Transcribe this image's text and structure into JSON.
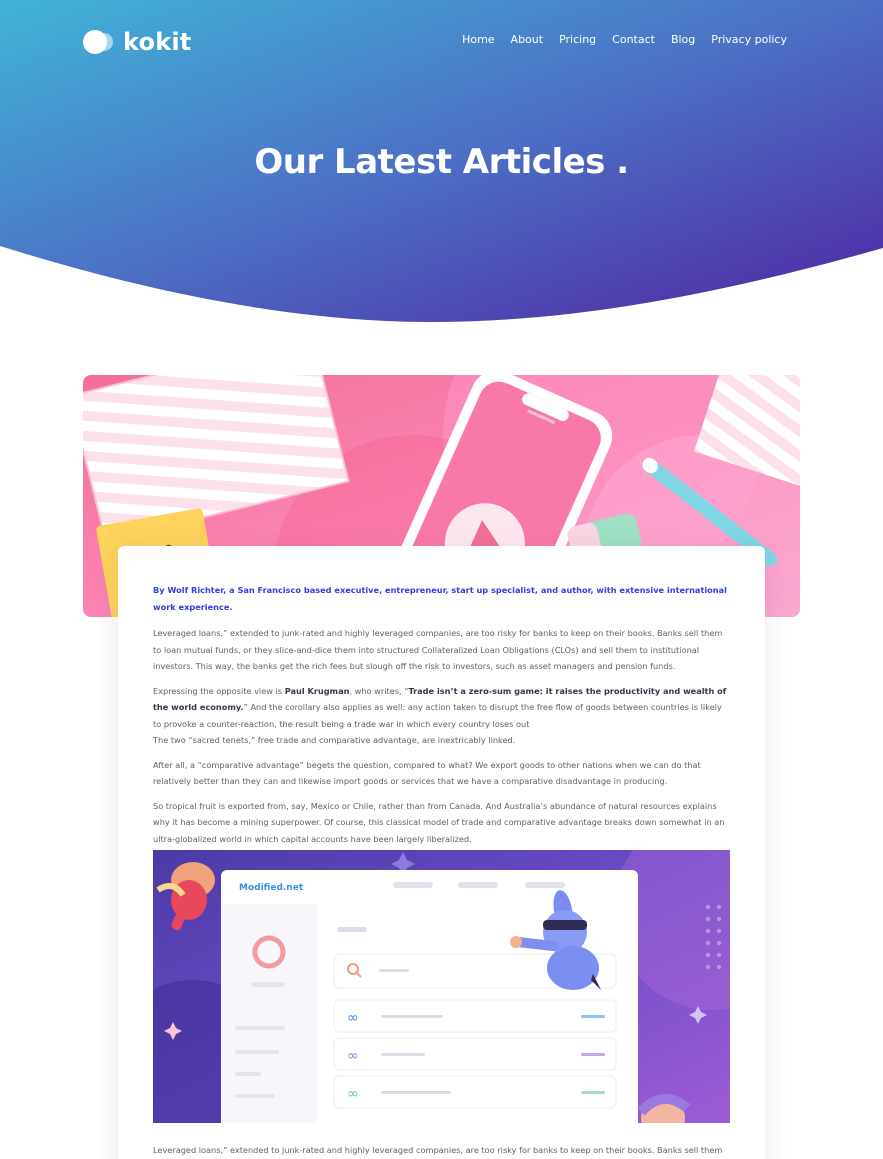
{
  "brand": {
    "name": "kokit"
  },
  "nav": {
    "items": [
      {
        "label": "Home"
      },
      {
        "label": "About"
      },
      {
        "label": "Pricing"
      },
      {
        "label": "Contact"
      },
      {
        "label": "Blog"
      },
      {
        "label": "Privacy policy"
      }
    ]
  },
  "hero": {
    "title": "Our Latest Articles .",
    "gradient_start": "#3fb3d8",
    "gradient_end": "#4f27a3"
  },
  "article": {
    "byline": "By Wolf Richter, a San Francisco based executive, entrepreneur, start up specialist, and author, with extensive international work experience.",
    "p1": "Leveraged loans,” extended to junk-rated and highly leveraged companies, are too risky for banks to keep on their books. Banks sell them to loan mutual funds, or they slice-and-dice them into structured Collateralized Loan Obligations (CLOs) and sell them to institutional investors. This way, the banks get the rich fees but slough off the risk to investors, such as asset managers and pension funds.",
    "p2_prefix": "Expressing the opposite view is ",
    "p2_name": "Paul Krugman",
    "p2_mid": ", who writes, “",
    "p2_quote": "Trade isn’t a zero-sum game: it raises the productivity and wealth of the world economy.",
    "p2_rest": "” And the corollary also applies as well: any action taken to disrupt the free flow of goods between countries is likely to provoke a counter-reaction, the result being a trade war in which every country loses out",
    "p2_line2": "The two “sacred tenets,” free trade and comparative advantage, are inextricably linked.",
    "p3": "After all, a “comparative advantage” begets the question, compared to what? We export goods to other nations when we can do that relatively better than they can and likewise import goods or services that we have a comparative disadvantage in producing.",
    "p4": "So tropical fruit is exported from, say, Mexico or Chile, rather than from Canada. And Australia’s abundance of natural resources explains why it has become a mining superpower. Of course, this classical model of trade and comparative advantage breaks down somewhat in an ultra-globalized world in which capital accounts have been largely liberalized.",
    "p5": "Leveraged loans,” extended to junk-rated and highly leveraged companies, are too risky for banks to keep on their books. Banks sell them to",
    "illustration_logo": "Modified.net"
  }
}
